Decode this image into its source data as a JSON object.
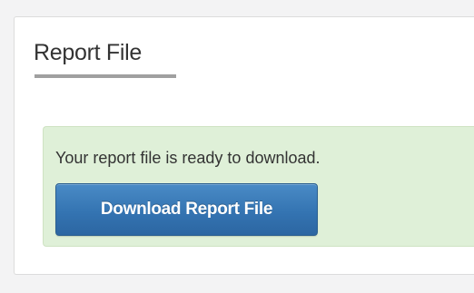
{
  "panel": {
    "title": "Report File",
    "alert": {
      "message": "Your report file is ready to download.",
      "button_label": "Download Report File"
    }
  },
  "colors": {
    "page_background": "#f3f3f4",
    "panel_background": "#ffffff",
    "alert_background": "#dff0d8",
    "button_primary": "#3474b2",
    "title_underline": "#a0a0a0"
  }
}
